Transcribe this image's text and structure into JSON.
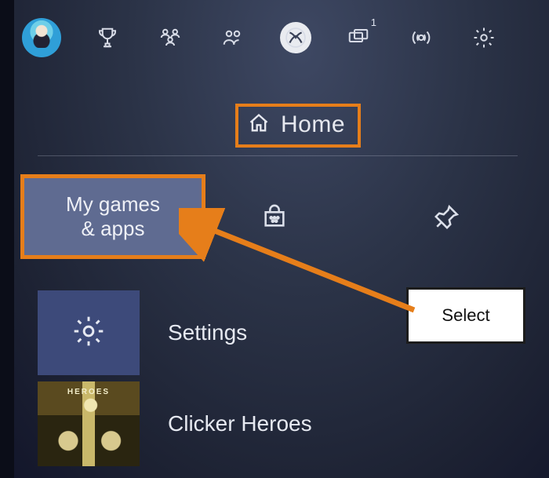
{
  "topbar": {
    "messages_badge": "1"
  },
  "home": {
    "label": "Home"
  },
  "tiles": {
    "my_games_apps": "My games\n& apps"
  },
  "rows": {
    "settings_label": "Settings",
    "game1_label": "Clicker Heroes"
  },
  "annotation": {
    "select_label": "Select"
  },
  "colors": {
    "highlight": "#e67e1a"
  }
}
